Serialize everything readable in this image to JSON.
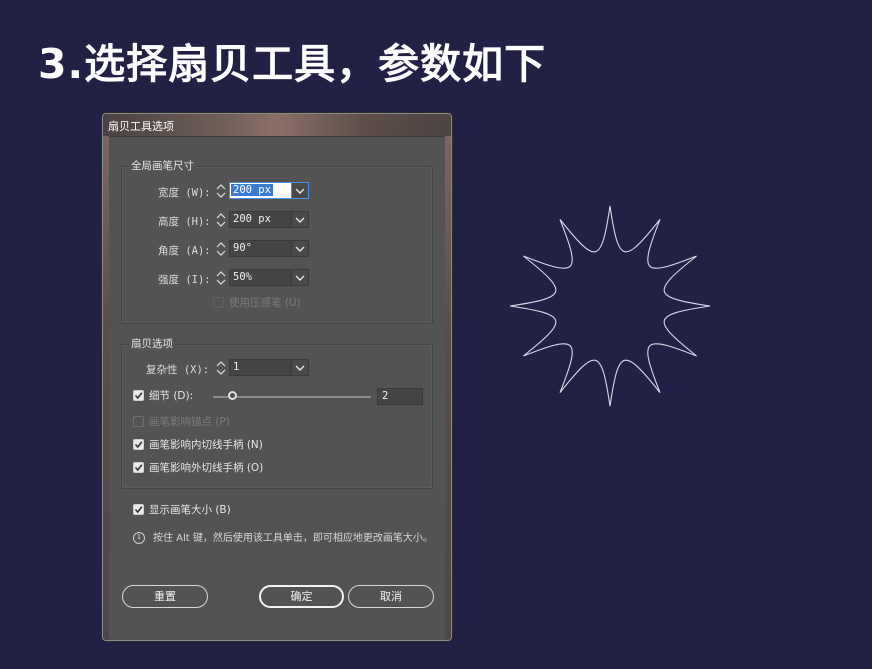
{
  "slide": {
    "title": "3.选择扇贝工具，参数如下"
  },
  "dialog": {
    "title": "扇贝工具选项",
    "global_brush": {
      "legend": "全局画笔尺寸",
      "width": {
        "label": "宽度 (W):",
        "value": "200 px"
      },
      "height": {
        "label": "高度 (H):",
        "value": "200 px"
      },
      "angle": {
        "label": "角度 (A):",
        "value": "90°"
      },
      "intensity": {
        "label": "强度 (I):",
        "value": "50%"
      },
      "use_pressure": {
        "label": "使用压感笔 (U)",
        "checked": false,
        "disabled": true
      }
    },
    "scallop_options": {
      "legend": "扇贝选项",
      "complexity": {
        "label": "复杂性 (X):",
        "value": "1"
      },
      "detail": {
        "label": "细节 (D):",
        "checked": true,
        "value": "2",
        "slider_fraction": 0.12
      },
      "brush_affects_anchor": {
        "label": "画笔影响锚点 (P)",
        "checked": false,
        "disabled": true
      },
      "brush_affects_in": {
        "label": "画笔影响内切线手柄 (N)",
        "checked": true
      },
      "brush_affects_out": {
        "label": "画笔影响外切线手柄 (O)",
        "checked": true
      }
    },
    "show_brush_size": {
      "label": "显示画笔大小 (B)",
      "checked": true
    },
    "info_text": "按住 Alt 键，然后使用该工具单击，即可相应地更改画笔大小。",
    "buttons": {
      "reset": "重置",
      "ok": "确定",
      "cancel": "取消"
    }
  },
  "colors": {
    "background": "#232046",
    "dialog": "#535353",
    "star_stroke": "#d8d8e8"
  },
  "icons": [
    "spinner-arrows-icon",
    "chevron-down-icon",
    "checkmark-icon",
    "info-icon",
    "scallop-star-icon"
  ]
}
